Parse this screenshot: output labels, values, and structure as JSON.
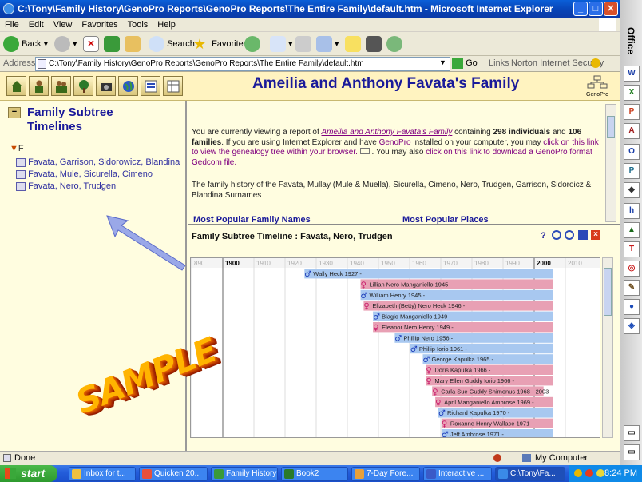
{
  "window": {
    "title": "C:\\Tony\\Family History\\GenoPro Reports\\GenoPro Reports\\The Entire Family\\default.htm - Microsoft Internet Explorer"
  },
  "menu": [
    "File",
    "Edit",
    "View",
    "Favorites",
    "Tools",
    "Help"
  ],
  "toolbar": {
    "back": "Back",
    "search": "Search",
    "favorites": "Favorites"
  },
  "address": {
    "label": "Address",
    "value": "C:\\Tony\\Family History\\GenoPro Reports\\GenoPro Reports\\The Entire Family\\default.htm",
    "go": "Go",
    "links": "Links",
    "norton": "Norton Internet Security"
  },
  "office_bar": {
    "label": "Office"
  },
  "page": {
    "title": "Ameilia and Anthony Favata's Family",
    "logo_text": "GenoPro",
    "subtree": {
      "heading_line1": "Family Subtree",
      "heading_line2": "Timelines",
      "letter": "F",
      "items": [
        "Favata, Garrison, Sidorowicz, Blandina",
        "Favata, Mule, Sicurella, Cimeno",
        "Favata, Nero, Trudgen"
      ]
    },
    "intro": {
      "p1_a": "You are currently viewing a report of ",
      "p1_link": "Ameilia and Anthony Favata's Family",
      "p1_b": " containing ",
      "p1_count_ind": "298 individuals",
      "p1_c": " and ",
      "p1_count_fam": "106 families",
      "p1_d": ". If you are using Internet Explorer and have ",
      "p1_genopro": "GenoPro",
      "p1_e": " installed on your computer, you may ",
      "p1_link2": "click on this link to view the genealogy tree within your browser.",
      "p1_f": " . You may also ",
      "p1_link3": "click on this link to download a GenoPro format Gedcom file.",
      "p2": "The family history of the Favata, Mullay (Mule & Muella), Sicurella, Cimeno, Nero, Trudgen, Garrison, Sidoroicz & Blandina Surnames",
      "h_names": "Most Popular Family Names",
      "h_places": "Most Popular Places"
    },
    "timeline": {
      "title": "Family Subtree Timeline : Favata, Nero, Trudgen",
      "years": [
        "890",
        "1900",
        "1910",
        "1920",
        "1930",
        "1940",
        "1950",
        "1960",
        "1970",
        "1980",
        "1990",
        "2000",
        "2010"
      ],
      "rows": [
        {
          "name": "Wally Heck 1927 -",
          "sex": "m",
          "start": 1927,
          "end": 2006
        },
        {
          "name": "Lillian Nero Manganiello 1945 -",
          "sex": "f",
          "start": 1945,
          "end": 2006
        },
        {
          "name": "William Henry 1945 -",
          "sex": "m",
          "start": 1945,
          "end": 2006
        },
        {
          "name": "Elizabeth (Betty) Nero Heck 1946 -",
          "sex": "f",
          "start": 1946,
          "end": 2006
        },
        {
          "name": "Biagio Manganiello 1949 -",
          "sex": "m",
          "start": 1949,
          "end": 2006
        },
        {
          "name": "Eleanor Nero Henry 1949 -",
          "sex": "f",
          "start": 1949,
          "end": 2006
        },
        {
          "name": "Phillip Nero 1956 -",
          "sex": "m",
          "start": 1956,
          "end": 2006
        },
        {
          "name": "Phillip Iorio 1961 -",
          "sex": "m",
          "start": 1961,
          "end": 2006
        },
        {
          "name": "George Kapulka 1965 -",
          "sex": "m",
          "start": 1965,
          "end": 2006
        },
        {
          "name": "Doris Kapulka 1966 -",
          "sex": "f",
          "start": 1966,
          "end": 2006
        },
        {
          "name": "Mary Ellen Guddy Iorio 1966 -",
          "sex": "f",
          "start": 1966,
          "end": 2006
        },
        {
          "name": "Carla Sue Guddy Shimonus 1968 - 2003",
          "sex": "f",
          "start": 1968,
          "end": 2003
        },
        {
          "name": "April Manganiello Ambrose 1969 -",
          "sex": "f",
          "start": 1969,
          "end": 2006
        },
        {
          "name": "Richard Kapulka 1970 -",
          "sex": "m",
          "start": 1970,
          "end": 2006
        },
        {
          "name": "Roxanne Henry Wallace 1971 -",
          "sex": "f",
          "start": 1971,
          "end": 2006
        },
        {
          "name": "Jeff Ambrose 1971 -",
          "sex": "m",
          "start": 1971,
          "end": 2006
        }
      ]
    },
    "watermark": "SAMPLE"
  },
  "status": {
    "left": "Done",
    "zone": "My Computer"
  },
  "taskbar": {
    "start": "start",
    "tasks": [
      "Inbox for t...",
      "Quicken 20...",
      "Family History",
      "Book2",
      "7-Day Fore...",
      "Interactive ...",
      "C:\\Tony\\Fa..."
    ],
    "time": "8:24 PM"
  },
  "colors": {
    "male_bar": "#a8c8f0",
    "female_bar": "#e8a0b4",
    "title_blue": "#1a1a9a"
  }
}
